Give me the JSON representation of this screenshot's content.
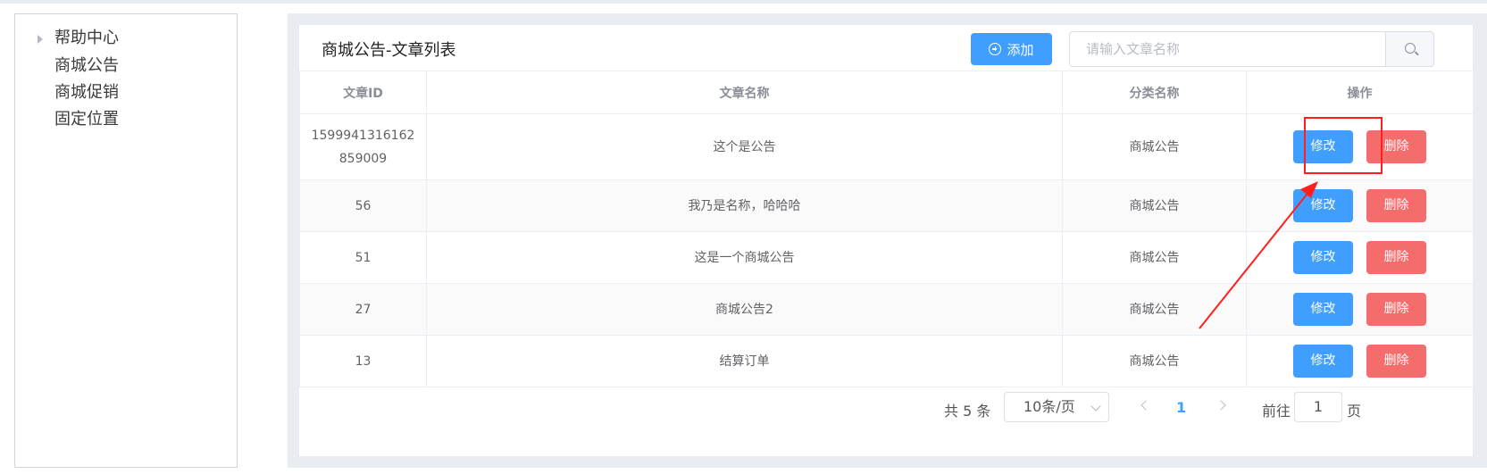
{
  "sidebar": {
    "items": [
      {
        "label": "帮助中心",
        "expandable": true
      },
      {
        "label": "商城公告",
        "expandable": false
      },
      {
        "label": "商城促销",
        "expandable": false
      },
      {
        "label": "固定位置",
        "expandable": false
      }
    ]
  },
  "header": {
    "title": "商城公告-文章列表",
    "add_label": "添加",
    "search_placeholder": "请输入文章名称"
  },
  "table": {
    "columns": [
      "文章ID",
      "文章名称",
      "分类名称",
      "操作"
    ],
    "rows": [
      {
        "id": "1599941316162859009",
        "name": "这个是公告",
        "category": "商城公告",
        "edit": "修改",
        "delete": "删除"
      },
      {
        "id": "56",
        "name": "我乃是名称，哈哈哈",
        "category": "商城公告",
        "edit": "修改",
        "delete": "删除"
      },
      {
        "id": "51",
        "name": "这是一个商城公告",
        "category": "商城公告",
        "edit": "修改",
        "delete": "删除"
      },
      {
        "id": "27",
        "name": "商城公告2",
        "category": "商城公告",
        "edit": "修改",
        "delete": "删除"
      },
      {
        "id": "13",
        "name": "结算订单",
        "category": "商城公告",
        "edit": "修改",
        "delete": "删除"
      }
    ]
  },
  "pagination": {
    "total_text": "共 5 条",
    "page_size": "10条/页",
    "current_page": "1",
    "goto_label": "前往",
    "goto_value": "1",
    "page_suffix": "页"
  },
  "colors": {
    "primary": "#409eff",
    "danger": "#f56c6c",
    "annotation": "#ff1f1f"
  }
}
